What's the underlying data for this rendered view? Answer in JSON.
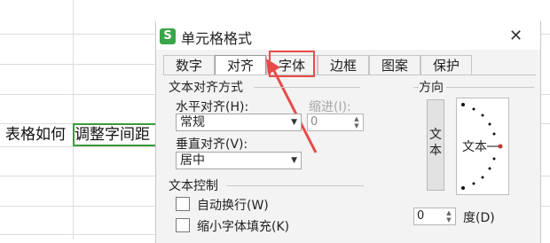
{
  "sheet": {
    "cell_text": "表格如何",
    "selected_cell_text": "调整字间距"
  },
  "dialog": {
    "title": "单元格格式",
    "tabs": [
      "数字",
      "对齐",
      "字体",
      "边框",
      "图案",
      "保护"
    ],
    "active_tab": "对齐",
    "text_alignment": {
      "group_label": "文本对齐方式",
      "horizontal_label": "水平对齐(H):",
      "horizontal_value": "常规",
      "indent_label": "缩进(I):",
      "indent_value": "0",
      "vertical_label": "垂直对齐(V):",
      "vertical_value": "居中"
    },
    "text_control": {
      "group_label": "文本控制",
      "wrap_label": "自动换行(W)",
      "shrink_label": "缩小字体填充(K)",
      "wrap_checked": false,
      "shrink_checked": false
    },
    "orientation": {
      "group_label": "方向",
      "vertical_text": "文本",
      "dial_text": "文本",
      "degrees_value": "0",
      "degrees_label": "度(D)"
    }
  },
  "colors": {
    "selection_border": "#3c9a3c",
    "highlight": "#e84a4a",
    "dial_dot": "#c0392b"
  }
}
